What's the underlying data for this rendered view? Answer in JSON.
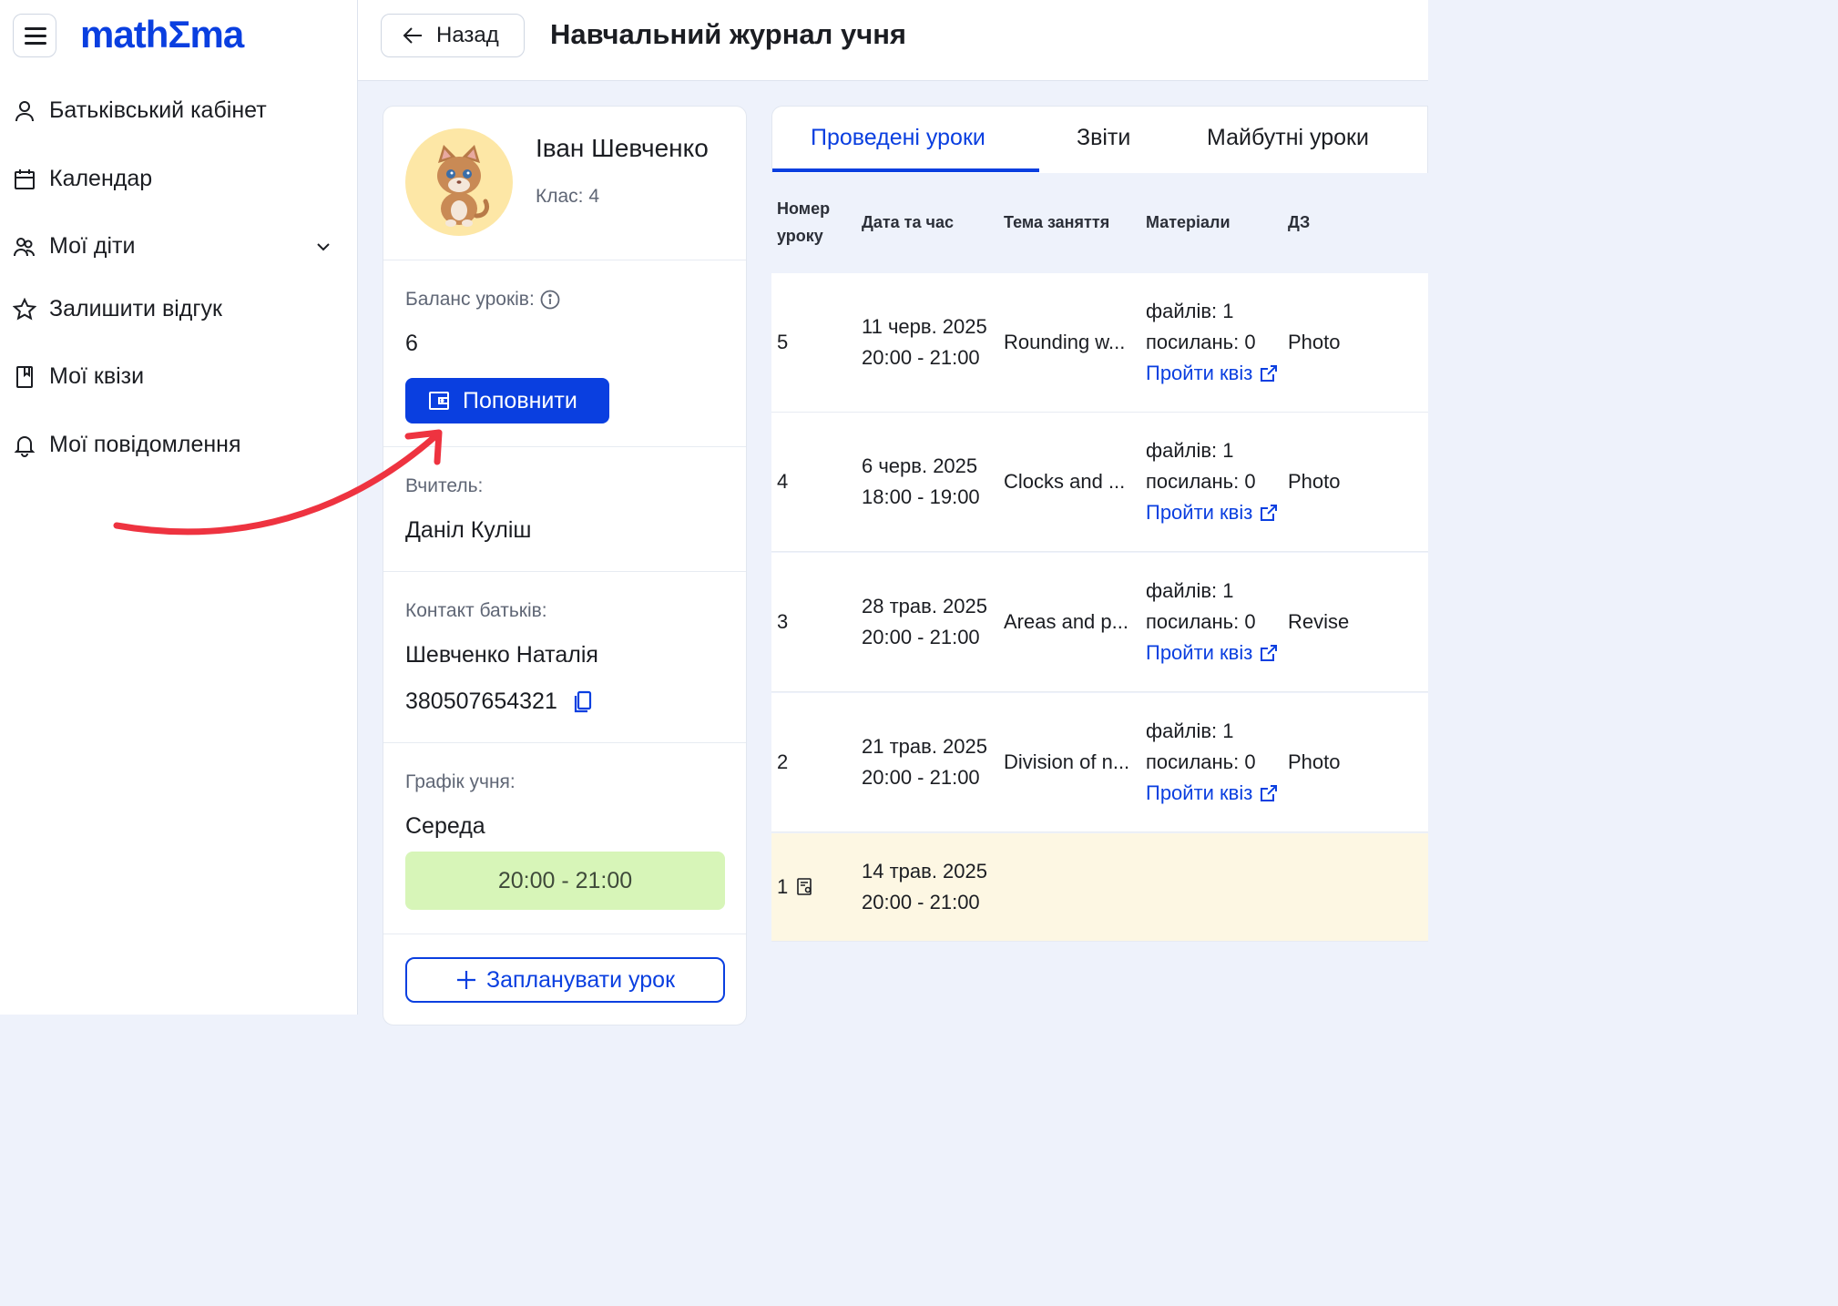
{
  "brand": {
    "logo": "mathΣma",
    "accent": "#0a3fe0"
  },
  "sidebar": {
    "items": [
      {
        "label": "Батьківський кабінет",
        "icon": "user-icon"
      },
      {
        "label": "Календар",
        "icon": "calendar-icon"
      },
      {
        "label": "Мої діти",
        "icon": "children-icon"
      },
      {
        "label": "Залишити відгук",
        "icon": "star-icon"
      },
      {
        "label": "Мої квізи",
        "icon": "bookmark-icon"
      },
      {
        "label": "Мої повідомлення",
        "icon": "bell-icon"
      }
    ]
  },
  "header": {
    "back_label": "Назад",
    "title": "Навчальний журнал учня"
  },
  "student": {
    "name": "Іван Шевченко",
    "grade": "Клас: 4",
    "balance_label": "Баланс уроків:",
    "balance_value": "6",
    "topup_label": "Поповнити",
    "teacher_label": "Вчитель:",
    "teacher_name": "Даніл Куліш",
    "contact_label": "Контакт батьків:",
    "contact_name": "Шевченко Наталія",
    "contact_phone": "380507654321",
    "schedule_label": "Графік учня:",
    "schedule_day": "Середа",
    "schedule_time": "20:00 - 21:00",
    "plan_label": "Запланувати урок"
  },
  "tabs": [
    "Проведені уроки",
    "Звіти",
    "Майбутні уроки"
  ],
  "table": {
    "headers": {
      "num_line1": "Номер",
      "num_line2": "уроку",
      "datetime": "Дата та час",
      "topic": "Тема заняття",
      "materials": "Матеріали",
      "hw": "ДЗ"
    },
    "rows": [
      {
        "num": "5",
        "date": "11 черв. 2025",
        "time": "20:00 - 21:00",
        "topic": "Rounding w...",
        "files": "файлів: 1",
        "links": "посилань: 0",
        "quiz": "Пройти квіз",
        "hw": "Photo"
      },
      {
        "num": "4",
        "date": "6 черв. 2025",
        "time": "18:00 - 19:00",
        "topic": "Clocks and ...",
        "files": "файлів: 1",
        "links": "посилань: 0",
        "quiz": "Пройти квіз",
        "hw": "Photo"
      },
      {
        "num": "3",
        "date": "28 трав. 2025",
        "time": "20:00 - 21:00",
        "topic": "Areas and p...",
        "files": "файлів: 1",
        "links": "посилань: 0",
        "quiz": "Пройти квіз",
        "hw": "Revise"
      },
      {
        "num": "2",
        "date": "21 трав. 2025",
        "time": "20:00 - 21:00",
        "topic": "Division of n...",
        "files": "файлів: 1",
        "links": "посилань: 0",
        "quiz": "Пройти квіз",
        "hw": "Photo"
      },
      {
        "num": "1",
        "date": "14 трав. 2025",
        "time": "20:00 - 21:00"
      }
    ]
  }
}
